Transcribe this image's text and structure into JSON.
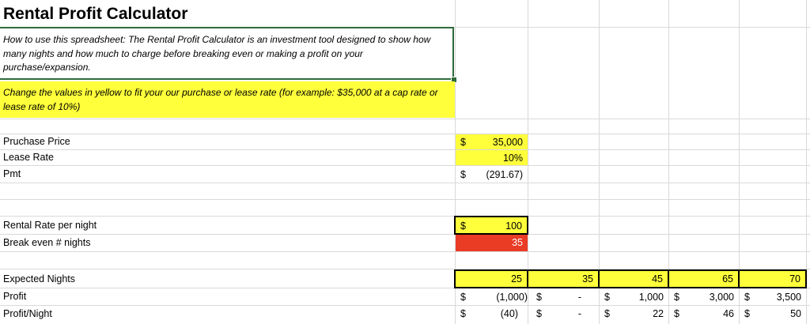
{
  "title": "Rental Profit Calculator",
  "how_to": "How to use this spreadsheet: The Rental Profit Calculator is an investment tool designed to show how many nights and how much to charge before breaking even or making a profit on your purchase/expansion.",
  "instruction": "Change the values in yellow to fit your our purchase or lease rate (for example: $35,000 at a cap rate or lease rate of 10%)",
  "inputs": {
    "purchase_price": {
      "label": "Pruchase Price",
      "currency": "$",
      "value": "35,000"
    },
    "lease_rate": {
      "label": "Lease Rate",
      "value": "10%"
    },
    "pmt": {
      "label": "Pmt",
      "currency": "$",
      "value": "(291.67)"
    }
  },
  "rental": {
    "rate_per_night": {
      "label": "Rental Rate per night",
      "currency": "$",
      "value": "100"
    },
    "break_even": {
      "label": "Break even # nights",
      "value": "35"
    }
  },
  "projection": {
    "expected_label": "Expected Nights",
    "profit_label": "Profit",
    "profit_night_label": "Profit/Night",
    "nights": [
      "25",
      "35",
      "45",
      "65",
      "70"
    ],
    "profit": [
      {
        "currency": "$",
        "value": "(1,000)"
      },
      {
        "currency": "$",
        "value": "-"
      },
      {
        "currency": "$",
        "value": "1,000"
      },
      {
        "currency": "$",
        "value": "3,000"
      },
      {
        "currency": "$",
        "value": "3,500"
      }
    ],
    "profit_night": [
      {
        "currency": "$",
        "value": "(40)"
      },
      {
        "currency": "$",
        "value": "-"
      },
      {
        "currency": "$",
        "value": "22"
      },
      {
        "currency": "$",
        "value": "46"
      },
      {
        "currency": "$",
        "value": "50"
      }
    ]
  },
  "colors": {
    "yellow": "#ffff3b",
    "red": "#ea3b25",
    "selection": "#2f6b3a",
    "gridline": "#d9d9d9"
  }
}
